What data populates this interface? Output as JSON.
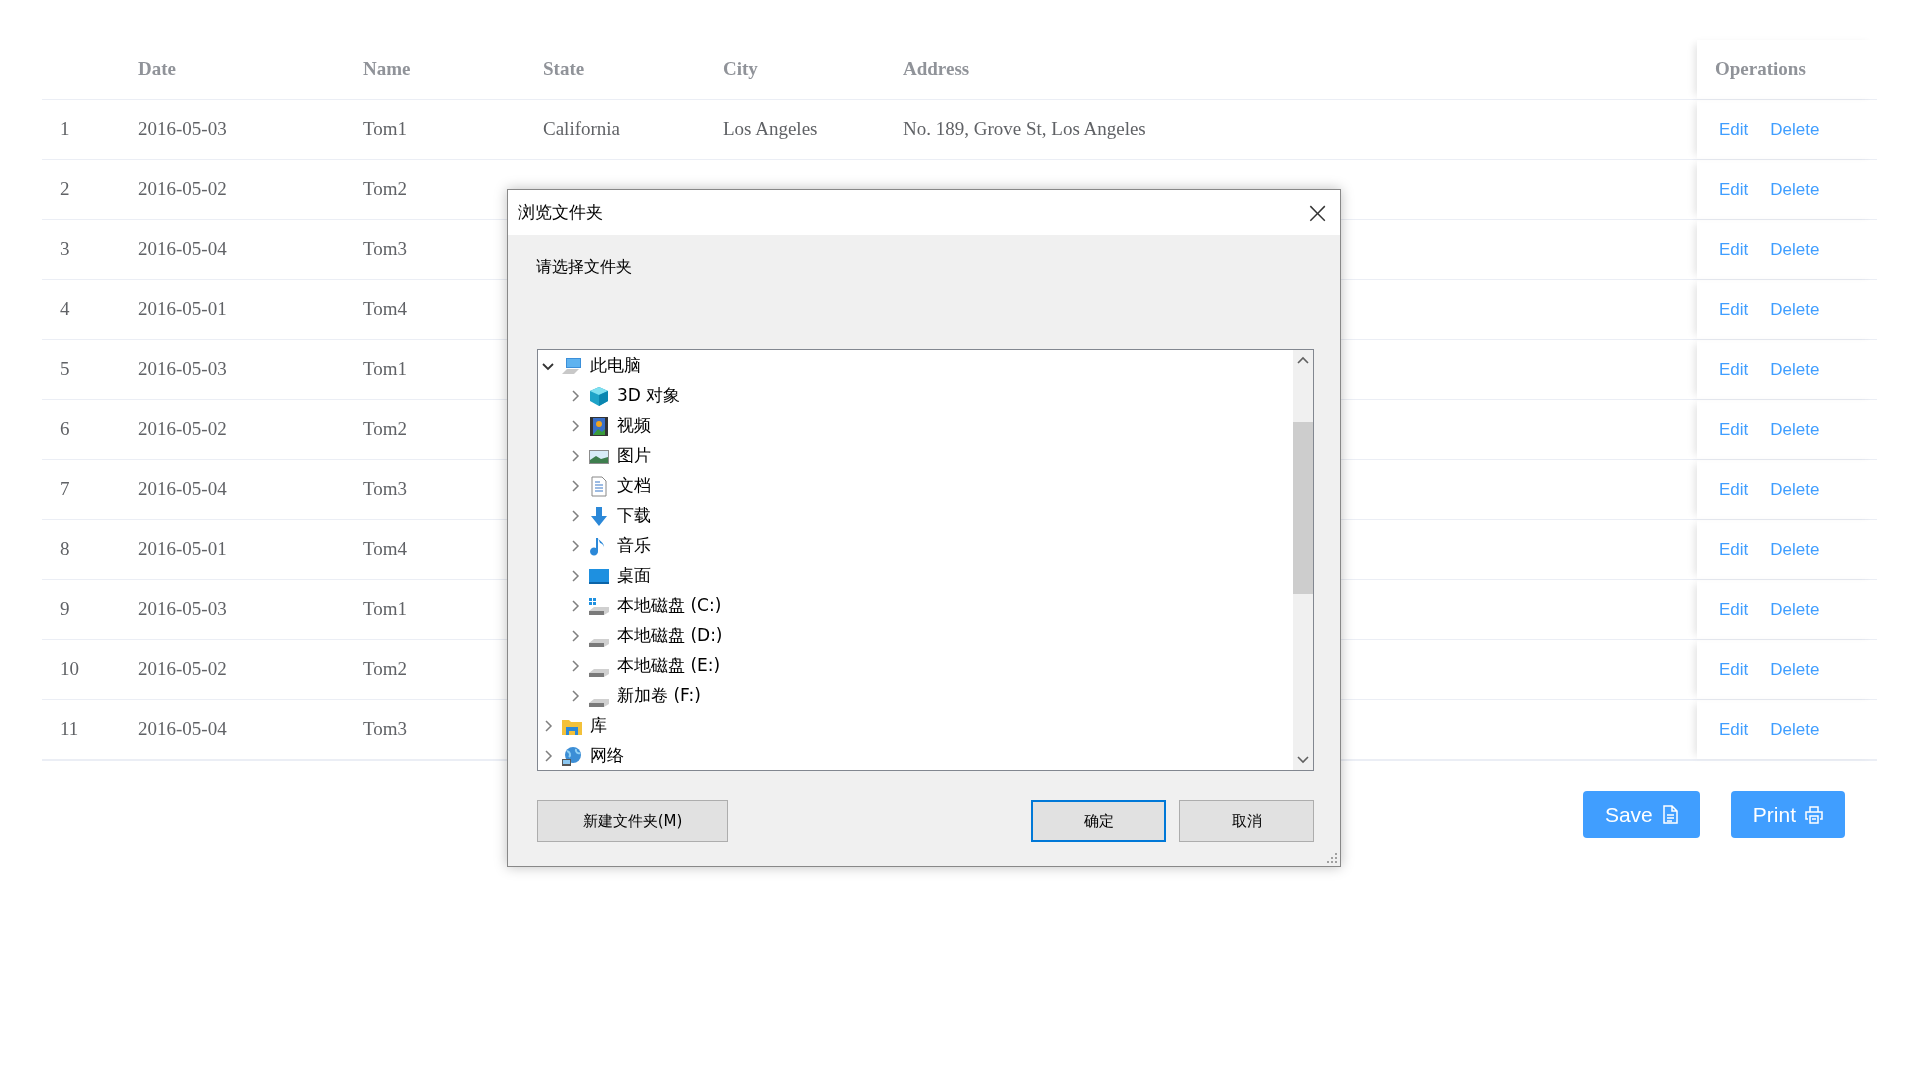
{
  "table": {
    "columns": [
      "Date",
      "Name",
      "State",
      "City",
      "Address",
      "Operations"
    ],
    "rows": [
      {
        "index": "1",
        "date": "2016-05-03",
        "name": "Tom1",
        "state": "California",
        "city": "Los Angeles",
        "address": "No. 189, Grove St, Los Angeles",
        "actions": [
          "Edit",
          "Delete"
        ]
      },
      {
        "index": "2",
        "date": "2016-05-02",
        "name": "Tom2",
        "actions": [
          "Edit",
          "Delete"
        ]
      },
      {
        "index": "3",
        "date": "2016-05-04",
        "name": "Tom3",
        "actions": [
          "Edit",
          "Delete"
        ]
      },
      {
        "index": "4",
        "date": "2016-05-01",
        "name": "Tom4",
        "actions": [
          "Edit",
          "Delete"
        ]
      },
      {
        "index": "5",
        "date": "2016-05-03",
        "name": "Tom1",
        "actions": [
          "Edit",
          "Delete"
        ]
      },
      {
        "index": "6",
        "date": "2016-05-02",
        "name": "Tom2",
        "actions": [
          "Edit",
          "Delete"
        ]
      },
      {
        "index": "7",
        "date": "2016-05-04",
        "name": "Tom3",
        "actions": [
          "Edit",
          "Delete"
        ]
      },
      {
        "index": "8",
        "date": "2016-05-01",
        "name": "Tom4",
        "actions": [
          "Edit",
          "Delete"
        ]
      },
      {
        "index": "9",
        "date": "2016-05-03",
        "name": "Tom1",
        "actions": [
          "Edit",
          "Delete"
        ]
      },
      {
        "index": "10",
        "date": "2016-05-02",
        "name": "Tom2",
        "actions": [
          "Edit",
          "Delete"
        ]
      },
      {
        "index": "11",
        "date": "2016-05-04",
        "name": "Tom3",
        "actions": [
          "Edit",
          "Delete"
        ]
      }
    ]
  },
  "buttons": [
    {
      "label": "Save",
      "kind": "save"
    },
    {
      "label": "Print",
      "kind": "print"
    }
  ],
  "dialog": {
    "title": "浏览文件夹",
    "close": "×",
    "prompt": "请选择文件夹",
    "tree": [
      {
        "label": "此电脑",
        "kind": "computer",
        "expanded": true,
        "children": [
          {
            "label": "3D 对象",
            "kind": "cube",
            "expanded": false
          },
          {
            "label": "视频",
            "kind": "video",
            "expanded": false
          },
          {
            "label": "图片",
            "kind": "pictures",
            "expanded": false
          },
          {
            "label": "文档",
            "kind": "documents",
            "expanded": false
          },
          {
            "label": "下载",
            "kind": "download",
            "expanded": false
          },
          {
            "label": "音乐",
            "kind": "music",
            "expanded": false
          },
          {
            "label": "桌面",
            "kind": "desktop",
            "expanded": false
          },
          {
            "label": "本地磁盘 (C:)",
            "kind": "system-drive",
            "expanded": false
          },
          {
            "label": "本地磁盘 (D:)",
            "kind": "drive",
            "expanded": false
          },
          {
            "label": "本地磁盘 (E:)",
            "kind": "drive",
            "expanded": false
          },
          {
            "label": "新加卷 (F:)",
            "kind": "drive",
            "expanded": false
          }
        ]
      },
      {
        "label": "库",
        "kind": "library",
        "expanded": false
      },
      {
        "label": "网络",
        "kind": "network",
        "expanded": false
      }
    ],
    "buttons": [
      {
        "label": "新建文件夹(M)",
        "default": false
      },
      {
        "label": "确定",
        "default": true
      },
      {
        "label": "取消",
        "default": false
      }
    ]
  }
}
